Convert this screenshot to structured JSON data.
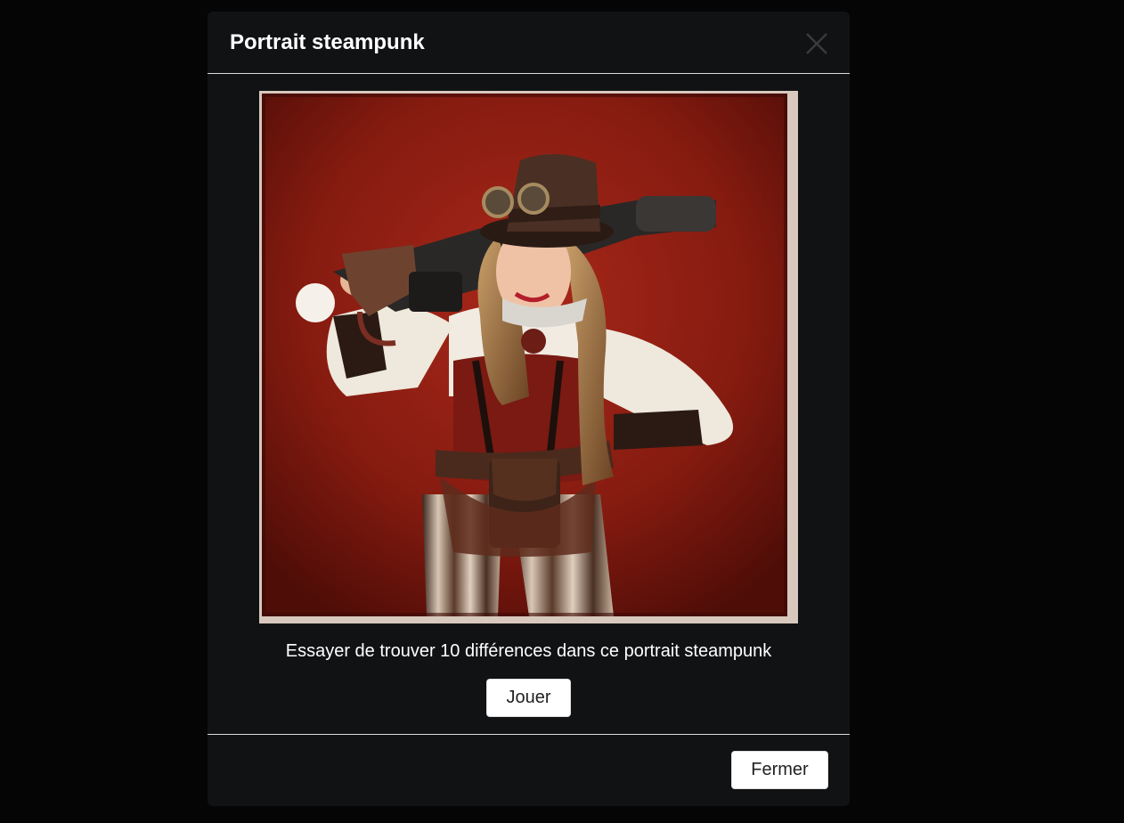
{
  "modal": {
    "title": "Portrait steampunk",
    "close_icon": "close-icon",
    "image_subject": "steampunk-woman-portrait",
    "description": "Essayer de trouver 10 différences dans ce portrait steampunk",
    "play_label": "Jouer",
    "close_label": "Fermer"
  },
  "colors": {
    "backdrop": "#050505",
    "modal_bg": "#111214",
    "divider": "#dcdcdc",
    "portrait_bg": "#8e1e12",
    "button_bg": "#ffffff"
  }
}
